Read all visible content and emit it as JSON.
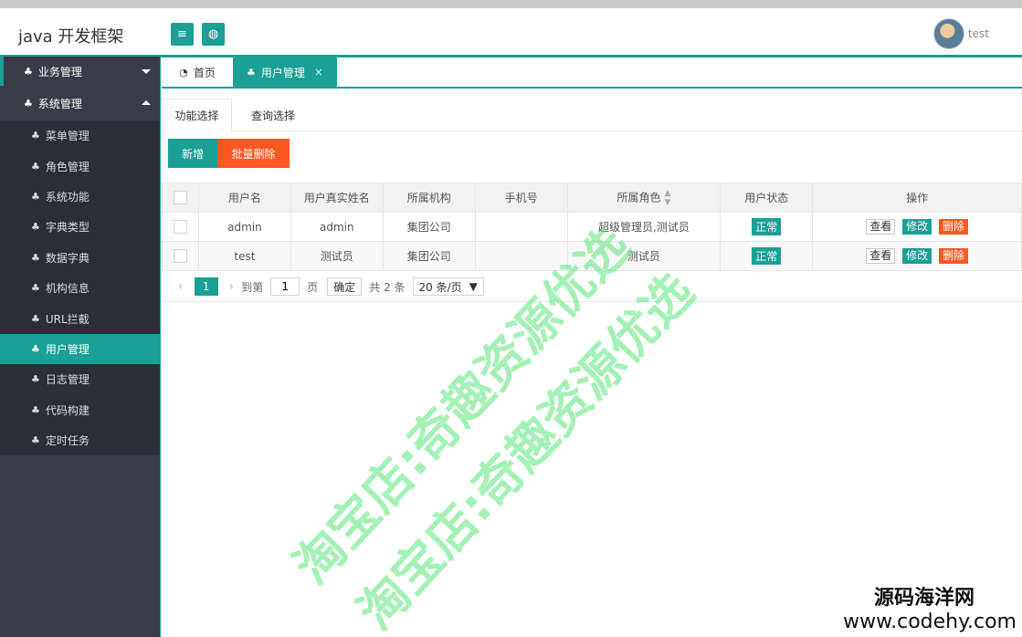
{
  "header": {
    "title": "java 开发框架",
    "user_name": "test"
  },
  "sidebar": {
    "groups": [
      {
        "label": "业务管理",
        "expanded": false
      },
      {
        "label": "系统管理",
        "expanded": true
      }
    ],
    "items": [
      "菜单管理",
      "角色管理",
      "系统功能",
      "字典类型",
      "数据字典",
      "机构信息",
      "URL拦截",
      "用户管理",
      "日志管理",
      "代码构建",
      "定时任务"
    ],
    "active_item": "用户管理"
  },
  "tabs": [
    {
      "label": "首页",
      "active": false
    },
    {
      "label": "用户管理",
      "active": true,
      "close": "×"
    }
  ],
  "subtabs": [
    "功能选择",
    "查询选择"
  ],
  "actions": {
    "add": "新增",
    "batch_delete": "批量删除"
  },
  "table": {
    "columns": [
      "用户名",
      "用户真实姓名",
      "所属机构",
      "手机号",
      "所属角色",
      "用户状态",
      "操作"
    ],
    "rows": [
      {
        "username": "admin",
        "realname": "admin",
        "org": "集团公司",
        "phone": "",
        "role": "超级管理员,测试员",
        "status": "正常"
      },
      {
        "username": "test",
        "realname": "测试员",
        "org": "集团公司",
        "phone": "",
        "role": "测试员",
        "status": "正常"
      }
    ],
    "ops": {
      "view": "查看",
      "edit": "修改",
      "remove": "删除"
    }
  },
  "pager": {
    "current": "1",
    "goto_label": "到第",
    "page_input": "1",
    "page_unit": "页",
    "confirm": "确定",
    "total": "共 2 条",
    "page_size": "20 条/页",
    "prev": "‹",
    "next": "›"
  },
  "watermark": {
    "line1": "淘宝店:奇趣资源优选",
    "line2": "淘宝店:奇趣资源优选"
  },
  "brand": {
    "line1": "源码海洋网",
    "line2": "www.codehy.com"
  },
  "colors": {
    "accent": "#1aa094",
    "danger": "#ff5722",
    "sidebar": "#393d49"
  }
}
